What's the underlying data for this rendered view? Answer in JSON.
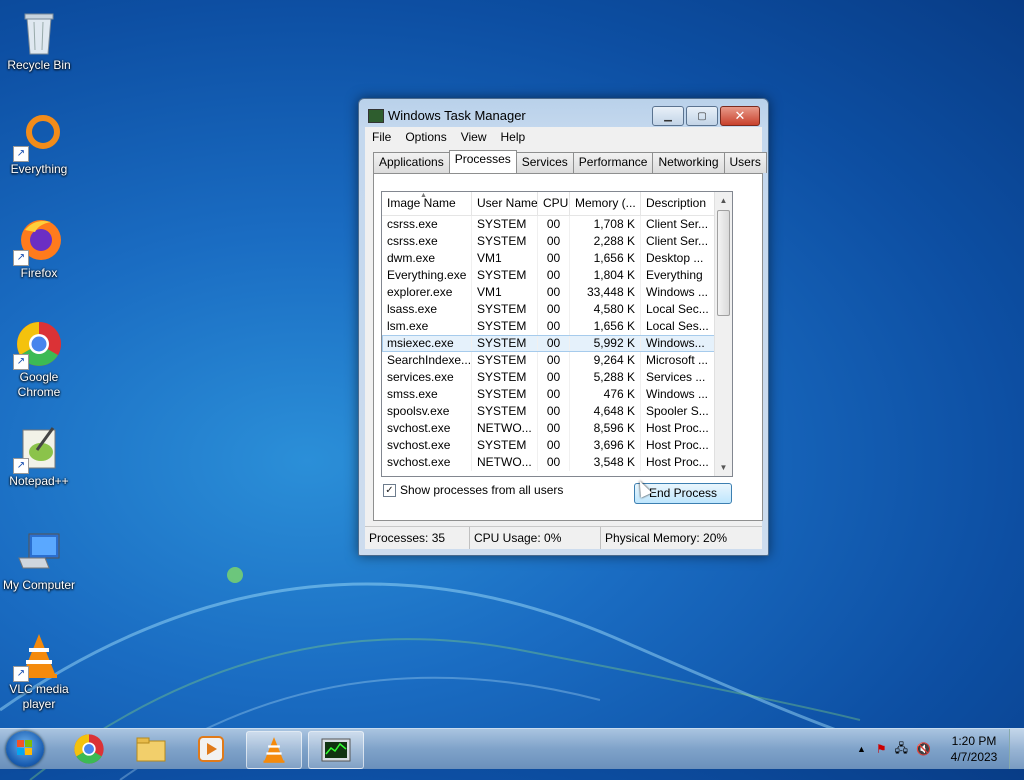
{
  "desktop": {
    "icons": [
      {
        "label": "Recycle Bin"
      },
      {
        "label": "Everything"
      },
      {
        "label": "Firefox"
      },
      {
        "label": "Google Chrome"
      },
      {
        "label": "Notepad++"
      },
      {
        "label": "My Computer"
      },
      {
        "label": "VLC media player"
      }
    ]
  },
  "window": {
    "title": "Windows Task Manager",
    "menu": [
      "File",
      "Options",
      "View",
      "Help"
    ],
    "tabs": [
      "Applications",
      "Processes",
      "Services",
      "Performance",
      "Networking",
      "Users"
    ],
    "active_tab": "Processes",
    "columns": [
      "Image Name",
      "User Name",
      "CPU",
      "Memory (...",
      "Description"
    ],
    "rows": [
      [
        "csrss.exe",
        "SYSTEM",
        "00",
        "1,708 K",
        "Client Ser..."
      ],
      [
        "csrss.exe",
        "SYSTEM",
        "00",
        "2,288 K",
        "Client Ser..."
      ],
      [
        "dwm.exe",
        "VM1",
        "00",
        "1,656 K",
        "Desktop ..."
      ],
      [
        "Everything.exe",
        "SYSTEM",
        "00",
        "1,804 K",
        "Everything"
      ],
      [
        "explorer.exe",
        "VM1",
        "00",
        "33,448 K",
        "Windows ..."
      ],
      [
        "lsass.exe",
        "SYSTEM",
        "00",
        "4,580 K",
        "Local Sec..."
      ],
      [
        "lsm.exe",
        "SYSTEM",
        "00",
        "1,656 K",
        "Local Ses..."
      ],
      [
        "msiexec.exe",
        "SYSTEM",
        "00",
        "5,992 K",
        "Windows..."
      ],
      [
        "SearchIndexe...",
        "SYSTEM",
        "00",
        "9,264 K",
        "Microsoft ..."
      ],
      [
        "services.exe",
        "SYSTEM",
        "00",
        "5,288 K",
        "Services ..."
      ],
      [
        "smss.exe",
        "SYSTEM",
        "00",
        "476 K",
        "Windows ..."
      ],
      [
        "spoolsv.exe",
        "SYSTEM",
        "00",
        "4,648 K",
        "Spooler S..."
      ],
      [
        "svchost.exe",
        "NETWO...",
        "00",
        "8,596 K",
        "Host Proc..."
      ],
      [
        "svchost.exe",
        "SYSTEM",
        "00",
        "3,696 K",
        "Host Proc..."
      ],
      [
        "svchost.exe",
        "NETWO...",
        "00",
        "3,548 K",
        "Host Proc..."
      ]
    ],
    "selected_row": 7,
    "show_all_label": "Show processes from all users",
    "show_all_checked": true,
    "end_process_label": "End Process",
    "status": {
      "processes": "Processes: 35",
      "cpu": "CPU Usage: 0%",
      "memory": "Physical Memory: 20%"
    }
  },
  "taskbar": {
    "items": [
      "windows-explorer",
      "google-chrome",
      "file-explorer",
      "media-player",
      "vlc",
      "task-manager"
    ],
    "clock_time": "1:20 PM",
    "clock_date": "4/7/2023"
  }
}
